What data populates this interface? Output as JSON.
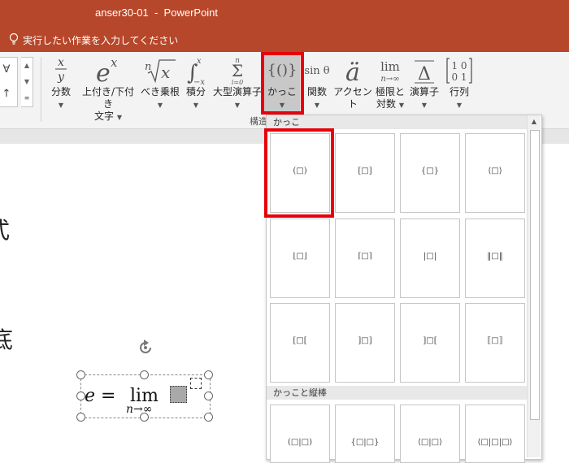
{
  "window": {
    "title": "anser30-01  -  PowerPoint"
  },
  "tellme": {
    "text": "実行したい作業を入力してください"
  },
  "symbols": {
    "row1": "∀",
    "row2": "↑"
  },
  "ribbon": {
    "buttons": [
      {
        "icon": "x/y",
        "label": "分数"
      },
      {
        "icon": "eˣ",
        "label": "上付き/下付き\n文字"
      },
      {
        "icon": "ⁿ√x",
        "label": "べき乗根"
      },
      {
        "icon": "∫",
        "label": "積分"
      },
      {
        "icon": "Σ",
        "label": "大型演算子"
      },
      {
        "icon": "{()}",
        "label": "かっこ"
      },
      {
        "icon": "sin θ",
        "label": "関数"
      },
      {
        "icon": "ä",
        "label": "アクセント"
      },
      {
        "icon": "lim",
        "label": "極限と\n対数"
      },
      {
        "icon": "Δ",
        "label": "演算子"
      },
      {
        "icon": "[10 01]",
        "label": "行列"
      }
    ],
    "group_label": "構造"
  },
  "gallery": {
    "section1": "かっこ",
    "section2": "かっこと縦棒",
    "tiles_row1": [
      "(□)",
      "[□]",
      "{□}",
      "⟨□⟩"
    ],
    "tiles_row2": [
      "⌊□⌋",
      "⌈□⌉",
      "|□|",
      "‖□‖"
    ],
    "tiles_row3": [
      "[□[",
      "]□]",
      "]□[",
      "⟦□⟧"
    ],
    "tiles_row4": [
      "(□|□)",
      "{□|□}",
      "⟨□|□⟩",
      "⟨□|□|□⟩"
    ]
  },
  "slide": {
    "chars": [
      "式",
      "底"
    ]
  },
  "equation": {
    "lhs": "e =",
    "lim": "lim",
    "sub": "n→∞"
  },
  "colors": {
    "accent": "#b7472a",
    "highlight": "#e8000b"
  }
}
